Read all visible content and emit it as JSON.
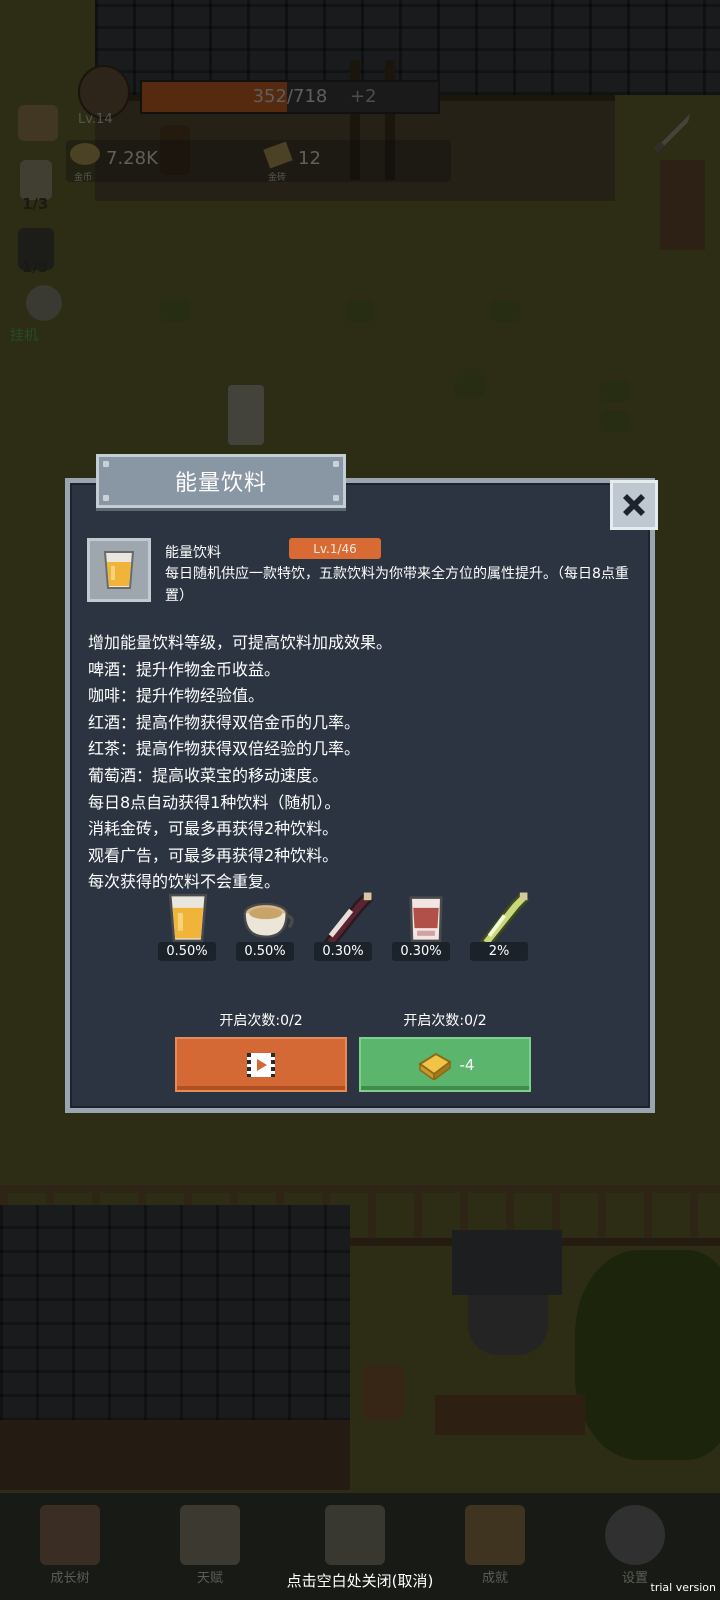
{
  "hud": {
    "xp_text": "352/718",
    "xp_fraction": 0.49,
    "plus": "+2",
    "level": "Lv.14",
    "coin_caption": "金币",
    "coin_value": "7.28K",
    "gold_caption": "金砖",
    "gold_value": "12"
  },
  "side": {
    "count_a": "1/3",
    "count_b": "1/5",
    "hangup_label": "挂机"
  },
  "dialog": {
    "title": "能量饮料",
    "item_name": "能量饮料",
    "item_level": "Lv.1/46",
    "item_desc": "每日随机供应一款特饮，五款饮料为你带来全方位的属性提升。（每日8点重置）",
    "lines": [
      "增加能量饮料等级，可提高饮料加成效果。",
      "啤酒：提升作物金币收益。",
      "咖啡：提升作物经验值。",
      "红酒：提高作物获得双倍金币的几率。",
      "红茶：提高作物获得双倍经验的几率。",
      "葡萄酒：提高收菜宝的移动速度。",
      "每日8点自动获得1种饮料（随机）。",
      "消耗金砖，可最多再获得2种饮料。",
      "观看广告，可最多再获得2种饮料。",
      "每次获得的饮料不会重复。"
    ],
    "drinks": [
      {
        "icon": "beer-icon",
        "pct": "0.50%"
      },
      {
        "icon": "coffee-icon",
        "pct": "0.50%"
      },
      {
        "icon": "red-wine-icon",
        "pct": "0.30%"
      },
      {
        "icon": "black-tea-icon",
        "pct": "0.30%"
      },
      {
        "icon": "grape-wine-icon",
        "pct": "2%"
      }
    ],
    "ad_count": "开启次数:0/2",
    "gold_count": "开启次数:0/2",
    "gold_cost": "-4"
  },
  "nav": {
    "items": [
      "成长树",
      "天赋",
      "",
      "成就",
      "设置"
    ]
  },
  "close_hint": "点击空白处关闭(取消)",
  "watermark": "trial version",
  "colors": {
    "dialog_bg": "#2b3440",
    "dialog_border": "#9aa5b1",
    "level_badge": "#d86a34",
    "ad_button": "#d46935",
    "gold_button": "#5cb56c"
  }
}
